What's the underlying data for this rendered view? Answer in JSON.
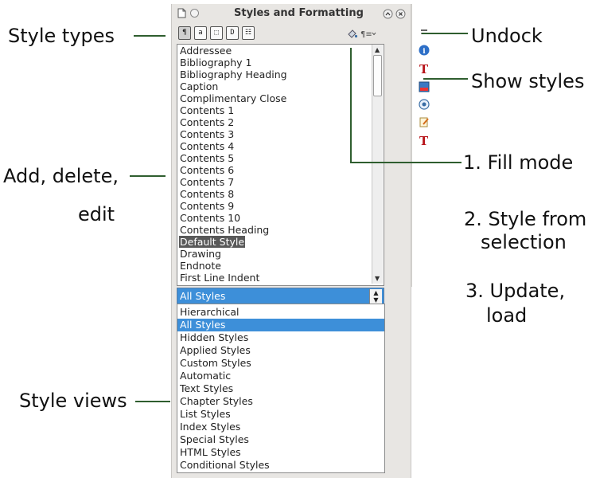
{
  "callouts": {
    "style_types": "Style types",
    "undock": "Undock",
    "show_styles": "Show styles",
    "add_delete_edit_line1": "Add, delete,",
    "add_delete_edit_line2": "edit",
    "fill_mode": "1. Fill mode",
    "style_from_selection_line1": "2. Style from",
    "style_from_selection_line2": "selection",
    "update_load_line1": "3. Update,",
    "update_load_line2": "load",
    "style_views": "Style views"
  },
  "window": {
    "title": "Styles and Formatting"
  },
  "toolbar": {
    "style_type_buttons": [
      "¶",
      "a",
      "⬚",
      "D",
      "☷"
    ],
    "fill_mode_icon": "fill-format-mode-icon",
    "new_style_icon": "new-style-from-selection-icon"
  },
  "styles_list": {
    "items": [
      "Addressee",
      "Bibliography 1",
      "Bibliography Heading",
      "Caption",
      "Complimentary Close",
      "Contents 1",
      "Contents 2",
      "Contents 3",
      "Contents 4",
      "Contents 5",
      "Contents 6",
      "Contents 7",
      "Contents 8",
      "Contents 9",
      "Contents 10",
      "Contents Heading",
      "Default Style",
      "Drawing",
      "Endnote",
      "First Line Indent"
    ],
    "selected": "Default Style"
  },
  "filter_combo": {
    "value": "All Styles"
  },
  "filter_dropdown": {
    "options": [
      "Hierarchical",
      "All Styles",
      "Hidden Styles",
      "Applied Styles",
      "Custom Styles",
      "Automatic",
      "Text Styles",
      "Chapter Styles",
      "List Styles",
      "Index Styles",
      "Special Styles",
      "HTML Styles",
      "Conditional Styles"
    ],
    "selected": "All Styles"
  },
  "sidebar_icons": [
    "undock-icon",
    "properties-icon",
    "styles-icon",
    "gallery-icon",
    "navigator-icon",
    "manage-changes-icon",
    "styles-icon-2"
  ],
  "colors": {
    "callout_line": "#2f5e2f",
    "selection_blue": "#3d8fd9",
    "list_selection": "#595959"
  }
}
